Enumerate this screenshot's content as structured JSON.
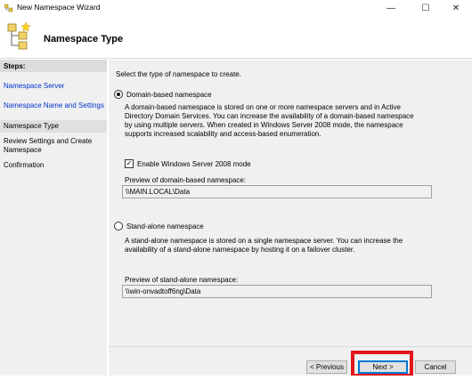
{
  "window": {
    "title": "New Namespace Wizard",
    "minimize_glyph": "—",
    "maximize_glyph": "☐",
    "close_glyph": "✕"
  },
  "header": {
    "title": "Namespace Type",
    "icon": "namespace-wizard-icon"
  },
  "sidebar": {
    "steps_label": "Steps:",
    "items": [
      {
        "label": "Namespace Server",
        "state": "link"
      },
      {
        "label": "Namespace Name and Settings",
        "state": "link"
      },
      {
        "label": "Namespace Type",
        "state": "current"
      },
      {
        "label": "Review Settings and Create Namespace",
        "state": "pending"
      },
      {
        "label": "Confirmation",
        "state": "pending"
      }
    ]
  },
  "main": {
    "instruction": "Select the type of namespace to create.",
    "domain_option": {
      "label": "Domain-based namespace",
      "selected": true,
      "description": "A domain-based namespace is stored on one or more namespace servers and in Active Directory Domain Services. You can increase the availability of a domain-based namespace by using multiple servers. When created in Windows Server 2008 mode, the namespace supports increased scalability and access-based enumeration.",
      "ws2008_label": "Enable Windows Server 2008 mode",
      "ws2008_checked": true,
      "preview_label": "Preview of domain-based namespace:",
      "preview_value": "\\\\MAIN.LOCAL\\Data"
    },
    "standalone_option": {
      "label": "Stand-alone namespace",
      "selected": false,
      "description": "A stand-alone namespace is stored on a single namespace server. You can increase the availability of a stand-alone namespace by hosting it on a failover cluster.",
      "preview_label": "Preview of stand-alone namespace:",
      "preview_value": "\\\\win-onvadtoff6ng\\Data"
    }
  },
  "footer": {
    "previous_label": "< Previous",
    "next_label": "Next >",
    "cancel_label": "Cancel"
  },
  "colors": {
    "link": "#0033cc",
    "highlight": "#e2161b",
    "default_button_border": "#0078d7"
  }
}
